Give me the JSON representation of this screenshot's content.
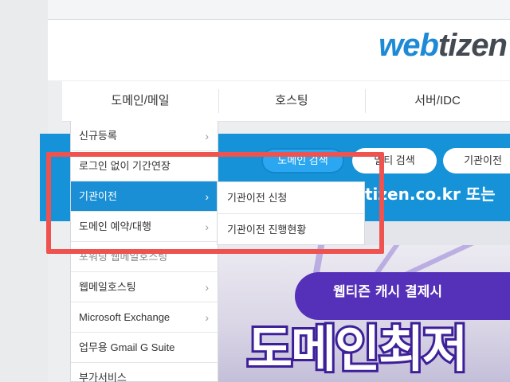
{
  "logo": {
    "part1": "web",
    "part2": "tizen"
  },
  "gnb": {
    "items": [
      {
        "label": "도메인/메일"
      },
      {
        "label": "호스팅"
      },
      {
        "label": "서버/IDC"
      }
    ]
  },
  "banner": {
    "tabs": [
      {
        "label": "도메인 검색"
      },
      {
        "label": "멀티 검색"
      },
      {
        "label": "기관이전"
      }
    ],
    "headline": "tizen.co.kr 또는",
    "ribbon_text": "웹티즌 캐시 결제시",
    "big_title": "도메인최저"
  },
  "dropdown": {
    "items": [
      {
        "label": "신규등록"
      },
      {
        "label": "로그인 없이 기간연장"
      },
      {
        "label": "기관이전"
      },
      {
        "label": "도메인 예약/대행"
      },
      {
        "label": "포워딩 웹메일호스팅"
      },
      {
        "label": "웹메일호스팅"
      },
      {
        "label": "Microsoft Exchange"
      },
      {
        "label": "업무용 Gmail G Suite"
      },
      {
        "label": "부가서비스"
      }
    ],
    "chevron": "›"
  },
  "submenu": {
    "items": [
      {
        "label": "기관이전 신청"
      },
      {
        "label": "기관이전 진행현황"
      }
    ]
  },
  "colors": {
    "accent": "#1a8fd6",
    "highlight": "#ef5350",
    "purple": "#5530b9"
  }
}
